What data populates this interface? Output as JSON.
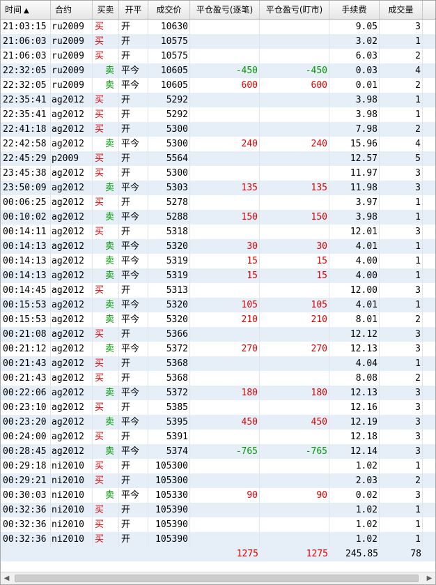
{
  "colors": {
    "buy": "#e00000",
    "sell": "#009900",
    "row_alt": "#e6eef8"
  },
  "header": {
    "time": "时间",
    "sort_indicator": "▲",
    "contract": "合约",
    "direction": "买卖",
    "open_close": "开平",
    "price": "成交价",
    "pnl_trade": "平仓盈亏(逐笔)",
    "pnl_mtm": "平仓盈亏(盯市)",
    "fee": "手续费",
    "volume": "成交量"
  },
  "rows": [
    {
      "time": "21:03:15",
      "contract": "ru2009",
      "dir": "买",
      "oc": "开",
      "price": "10630",
      "pnl1": "",
      "pnl2": "",
      "fee": "9.05",
      "vol": "3"
    },
    {
      "time": "21:06:03",
      "contract": "ru2009",
      "dir": "买",
      "oc": "开",
      "price": "10575",
      "pnl1": "",
      "pnl2": "",
      "fee": "3.02",
      "vol": "1"
    },
    {
      "time": "21:06:03",
      "contract": "ru2009",
      "dir": "买",
      "oc": "开",
      "price": "10575",
      "pnl1": "",
      "pnl2": "",
      "fee": "6.03",
      "vol": "2"
    },
    {
      "time": "22:32:05",
      "contract": "ru2009",
      "dir": "卖",
      "oc": "平今",
      "price": "10605",
      "pnl1": "-450",
      "pnl2": "-450",
      "fee": "0.03",
      "vol": "4"
    },
    {
      "time": "22:32:05",
      "contract": "ru2009",
      "dir": "卖",
      "oc": "平今",
      "price": "10605",
      "pnl1": "600",
      "pnl2": "600",
      "fee": "0.01",
      "vol": "2"
    },
    {
      "time": "22:35:41",
      "contract": "ag2012",
      "dir": "买",
      "oc": "开",
      "price": "5292",
      "pnl1": "",
      "pnl2": "",
      "fee": "3.98",
      "vol": "1"
    },
    {
      "time": "22:35:41",
      "contract": "ag2012",
      "dir": "买",
      "oc": "开",
      "price": "5292",
      "pnl1": "",
      "pnl2": "",
      "fee": "3.98",
      "vol": "1"
    },
    {
      "time": "22:41:18",
      "contract": "ag2012",
      "dir": "买",
      "oc": "开",
      "price": "5300",
      "pnl1": "",
      "pnl2": "",
      "fee": "7.98",
      "vol": "2"
    },
    {
      "time": "22:42:58",
      "contract": "ag2012",
      "dir": "卖",
      "oc": "平今",
      "price": "5300",
      "pnl1": "240",
      "pnl2": "240",
      "fee": "15.96",
      "vol": "4"
    },
    {
      "time": "22:45:29",
      "contract": "p2009",
      "dir": "买",
      "oc": "开",
      "price": "5564",
      "pnl1": "",
      "pnl2": "",
      "fee": "12.57",
      "vol": "5"
    },
    {
      "time": "23:45:38",
      "contract": "ag2012",
      "dir": "买",
      "oc": "开",
      "price": "5300",
      "pnl1": "",
      "pnl2": "",
      "fee": "11.97",
      "vol": "3"
    },
    {
      "time": "23:50:09",
      "contract": "ag2012",
      "dir": "卖",
      "oc": "平今",
      "price": "5303",
      "pnl1": "135",
      "pnl2": "135",
      "fee": "11.98",
      "vol": "3"
    },
    {
      "time": "00:06:25",
      "contract": "ag2012",
      "dir": "买",
      "oc": "开",
      "price": "5278",
      "pnl1": "",
      "pnl2": "",
      "fee": "3.97",
      "vol": "1"
    },
    {
      "time": "00:10:02",
      "contract": "ag2012",
      "dir": "卖",
      "oc": "平今",
      "price": "5288",
      "pnl1": "150",
      "pnl2": "150",
      "fee": "3.98",
      "vol": "1"
    },
    {
      "time": "00:14:11",
      "contract": "ag2012",
      "dir": "买",
      "oc": "开",
      "price": "5318",
      "pnl1": "",
      "pnl2": "",
      "fee": "12.01",
      "vol": "3"
    },
    {
      "time": "00:14:13",
      "contract": "ag2012",
      "dir": "卖",
      "oc": "平今",
      "price": "5320",
      "pnl1": "30",
      "pnl2": "30",
      "fee": "4.01",
      "vol": "1"
    },
    {
      "time": "00:14:13",
      "contract": "ag2012",
      "dir": "卖",
      "oc": "平今",
      "price": "5319",
      "pnl1": "15",
      "pnl2": "15",
      "fee": "4.00",
      "vol": "1"
    },
    {
      "time": "00:14:13",
      "contract": "ag2012",
      "dir": "卖",
      "oc": "平今",
      "price": "5319",
      "pnl1": "15",
      "pnl2": "15",
      "fee": "4.00",
      "vol": "1"
    },
    {
      "time": "00:14:45",
      "contract": "ag2012",
      "dir": "买",
      "oc": "开",
      "price": "5313",
      "pnl1": "",
      "pnl2": "",
      "fee": "12.00",
      "vol": "3"
    },
    {
      "time": "00:15:53",
      "contract": "ag2012",
      "dir": "卖",
      "oc": "平今",
      "price": "5320",
      "pnl1": "105",
      "pnl2": "105",
      "fee": "4.01",
      "vol": "1"
    },
    {
      "time": "00:15:53",
      "contract": "ag2012",
      "dir": "卖",
      "oc": "平今",
      "price": "5320",
      "pnl1": "210",
      "pnl2": "210",
      "fee": "8.01",
      "vol": "2"
    },
    {
      "time": "00:21:08",
      "contract": "ag2012",
      "dir": "买",
      "oc": "开",
      "price": "5366",
      "pnl1": "",
      "pnl2": "",
      "fee": "12.12",
      "vol": "3"
    },
    {
      "time": "00:21:12",
      "contract": "ag2012",
      "dir": "卖",
      "oc": "平今",
      "price": "5372",
      "pnl1": "270",
      "pnl2": "270",
      "fee": "12.13",
      "vol": "3"
    },
    {
      "time": "00:21:43",
      "contract": "ag2012",
      "dir": "买",
      "oc": "开",
      "price": "5368",
      "pnl1": "",
      "pnl2": "",
      "fee": "4.04",
      "vol": "1"
    },
    {
      "time": "00:21:43",
      "contract": "ag2012",
      "dir": "买",
      "oc": "开",
      "price": "5368",
      "pnl1": "",
      "pnl2": "",
      "fee": "8.08",
      "vol": "2"
    },
    {
      "time": "00:22:06",
      "contract": "ag2012",
      "dir": "卖",
      "oc": "平今",
      "price": "5372",
      "pnl1": "180",
      "pnl2": "180",
      "fee": "12.13",
      "vol": "3"
    },
    {
      "time": "00:23:10",
      "contract": "ag2012",
      "dir": "买",
      "oc": "开",
      "price": "5385",
      "pnl1": "",
      "pnl2": "",
      "fee": "12.16",
      "vol": "3"
    },
    {
      "time": "00:23:20",
      "contract": "ag2012",
      "dir": "卖",
      "oc": "平今",
      "price": "5395",
      "pnl1": "450",
      "pnl2": "450",
      "fee": "12.19",
      "vol": "3"
    },
    {
      "time": "00:24:00",
      "contract": "ag2012",
      "dir": "买",
      "oc": "开",
      "price": "5391",
      "pnl1": "",
      "pnl2": "",
      "fee": "12.18",
      "vol": "3"
    },
    {
      "time": "00:28:45",
      "contract": "ag2012",
      "dir": "卖",
      "oc": "平今",
      "price": "5374",
      "pnl1": "-765",
      "pnl2": "-765",
      "fee": "12.14",
      "vol": "3"
    },
    {
      "time": "00:29:18",
      "contract": "ni2010",
      "dir": "买",
      "oc": "开",
      "price": "105300",
      "pnl1": "",
      "pnl2": "",
      "fee": "1.02",
      "vol": "1"
    },
    {
      "time": "00:29:21",
      "contract": "ni2010",
      "dir": "买",
      "oc": "开",
      "price": "105300",
      "pnl1": "",
      "pnl2": "",
      "fee": "2.03",
      "vol": "2"
    },
    {
      "time": "00:30:03",
      "contract": "ni2010",
      "dir": "卖",
      "oc": "平今",
      "price": "105330",
      "pnl1": "90",
      "pnl2": "90",
      "fee": "0.02",
      "vol": "3"
    },
    {
      "time": "00:32:36",
      "contract": "ni2010",
      "dir": "买",
      "oc": "开",
      "price": "105390",
      "pnl1": "",
      "pnl2": "",
      "fee": "1.02",
      "vol": "1"
    },
    {
      "time": "00:32:36",
      "contract": "ni2010",
      "dir": "买",
      "oc": "开",
      "price": "105390",
      "pnl1": "",
      "pnl2": "",
      "fee": "1.02",
      "vol": "1"
    },
    {
      "time": "00:32:36",
      "contract": "ni2010",
      "dir": "买",
      "oc": "开",
      "price": "105390",
      "pnl1": "",
      "pnl2": "",
      "fee": "1.02",
      "vol": "1"
    }
  ],
  "totals": {
    "pnl1": "1275",
    "pnl2": "1275",
    "fee": "245.85",
    "vol": "78"
  },
  "scrollbar": {
    "left_arrow": "◀",
    "right_arrow": "▶"
  }
}
